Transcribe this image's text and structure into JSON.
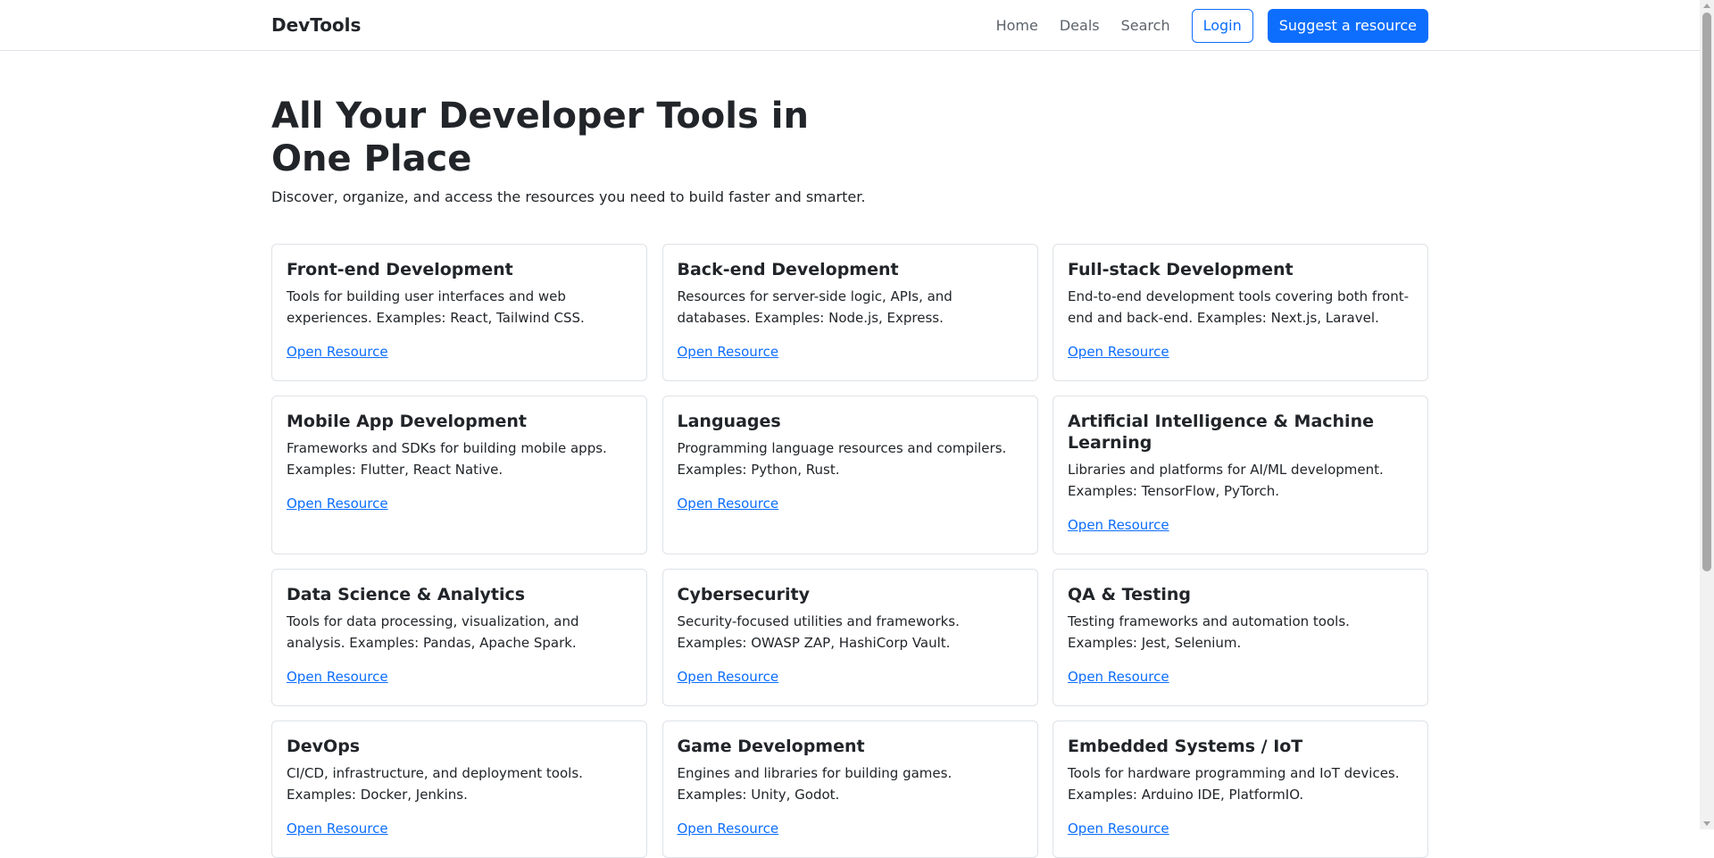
{
  "nav": {
    "brand": "DevTools",
    "links": [
      "Home",
      "Deals",
      "Search"
    ],
    "login_label": "Login",
    "suggest_label": "Suggest a resource"
  },
  "hero": {
    "title": "All Your Developer Tools in One Place",
    "subtitle": "Discover, organize, and access the resources you need to build faster and smarter."
  },
  "cards": [
    {
      "title": "Front-end Development",
      "description": "Tools for building user interfaces and web experiences. Examples: React, Tailwind CSS.",
      "link": "Open Resource"
    },
    {
      "title": "Back-end Development",
      "description": "Resources for server-side logic, APIs, and databases. Examples: Node.js, Express.",
      "link": "Open Resource"
    },
    {
      "title": "Full-stack Development",
      "description": "End-to-end development tools covering both front-end and back-end. Examples: Next.js, Laravel.",
      "link": "Open Resource"
    },
    {
      "title": "Mobile App Development",
      "description": "Frameworks and SDKs for building mobile apps. Examples: Flutter, React Native.",
      "link": "Open Resource"
    },
    {
      "title": "Languages",
      "description": "Programming language resources and compilers. Examples: Python, Rust.",
      "link": "Open Resource"
    },
    {
      "title": "Artificial Intelligence & Machine Learning",
      "description": "Libraries and platforms for AI/ML development. Examples: TensorFlow, PyTorch.",
      "link": "Open Resource"
    },
    {
      "title": "Data Science & Analytics",
      "description": "Tools for data processing, visualization, and analysis. Examples: Pandas, Apache Spark.",
      "link": "Open Resource"
    },
    {
      "title": "Cybersecurity",
      "description": "Security-focused utilities and frameworks. Examples: OWASP ZAP, HashiCorp Vault.",
      "link": "Open Resource"
    },
    {
      "title": "QA & Testing",
      "description": "Testing frameworks and automation tools. Examples: Jest, Selenium.",
      "link": "Open Resource"
    },
    {
      "title": "DevOps",
      "description": "CI/CD, infrastructure, and deployment tools. Examples: Docker, Jenkins.",
      "link": "Open Resource"
    },
    {
      "title": "Game Development",
      "description": "Engines and libraries for building games. Examples: Unity, Godot.",
      "link": "Open Resource"
    },
    {
      "title": "Embedded Systems / IoT",
      "description": "Tools for hardware programming and IoT devices. Examples: Arduino IDE, PlatformIO.",
      "link": "Open Resource"
    }
  ],
  "colors": {
    "accent": "#0d6efd",
    "text": "#212529",
    "muted": "#5c636a",
    "border": "#dee2e6"
  }
}
